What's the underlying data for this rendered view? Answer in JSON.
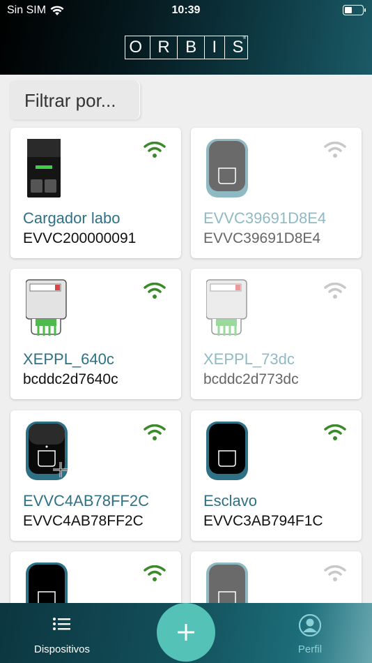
{
  "status_bar": {
    "carrier": "Sin SIM",
    "time": "10:39",
    "battery_level": 0.4
  },
  "header": {
    "logo_letters": [
      "O",
      "R",
      "B",
      "I",
      "S"
    ],
    "logo_mark": "®"
  },
  "filter": {
    "placeholder": "Filtrar por..."
  },
  "devices": [
    {
      "name": "Cargador labo",
      "serial": "EVVC200000091",
      "online": true,
      "icon": "charger-box-icon"
    },
    {
      "name": "EVVC39691D8E4",
      "serial": "EVVC39691D8E4",
      "online": false,
      "icon": "charger-wallbox-icon"
    },
    {
      "name": "XEPPL_640c",
      "serial": "bcddc2d7640c",
      "online": true,
      "icon": "meter-icon"
    },
    {
      "name": "XEPPL_73dc",
      "serial": "bcddc2d773dc",
      "online": false,
      "icon": "meter-icon"
    },
    {
      "name": "EVVC4AB78FF2C",
      "serial": "EVVC4AB78FF2C",
      "online": true,
      "icon": "charger-wallbox-icon"
    },
    {
      "name": "Esclavo",
      "serial": "EVVC3AB794F1C",
      "online": true,
      "icon": "charger-wallbox-icon"
    },
    {
      "name": "",
      "serial": "",
      "online": true,
      "icon": "charger-wallbox-icon"
    },
    {
      "name": "",
      "serial": "",
      "online": false,
      "icon": "charger-wallbox-icon"
    }
  ],
  "colors": {
    "accent": "#2e7185",
    "online_wifi": "#3a8a2a",
    "offline_wifi": "#c8c8c8",
    "fab": "#54c2b7"
  },
  "tabbar": {
    "devices_label": "Dispositivos",
    "profile_label": "Perfil"
  }
}
